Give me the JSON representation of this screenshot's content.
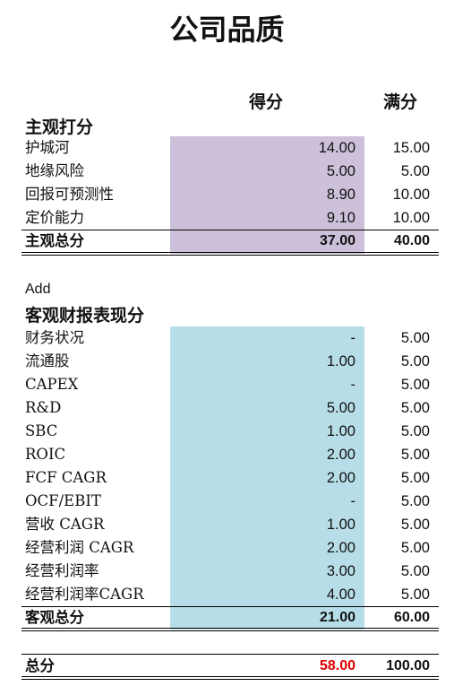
{
  "title": "公司品质",
  "headers": {
    "score": "得分",
    "full": "满分"
  },
  "colors": {
    "subjective_bg": "#ccc0da",
    "objective_bg": "#b7dee8",
    "total_score": "#e00000"
  },
  "subjective": {
    "heading": "主观打分",
    "rows": [
      {
        "label": "护城河",
        "score": "14.00",
        "full": "15.00"
      },
      {
        "label": "地缘风险",
        "score": "5.00",
        "full": "5.00"
      },
      {
        "label": "回报可预测性",
        "score": "8.90",
        "full": "10.00"
      },
      {
        "label": "定价能力",
        "score": "9.10",
        "full": "10.00"
      }
    ],
    "total": {
      "label": "主观总分",
      "score": "37.00",
      "full": "40.00"
    }
  },
  "add_label": "Add",
  "objective": {
    "heading": "客观财报表现分",
    "rows": [
      {
        "label": "财务状况",
        "score": "-",
        "full": "5.00"
      },
      {
        "label": "流通股",
        "score": "1.00",
        "full": "5.00"
      },
      {
        "label": "CAPEX",
        "score": "-",
        "full": "5.00"
      },
      {
        "label": "R&D",
        "score": "5.00",
        "full": "5.00"
      },
      {
        "label": "SBC",
        "score": "1.00",
        "full": "5.00"
      },
      {
        "label": "ROIC",
        "score": "2.00",
        "full": "5.00"
      },
      {
        "label": "FCF CAGR",
        "score": "2.00",
        "full": "5.00"
      },
      {
        "label": "OCF/EBIT",
        "score": "-",
        "full": "5.00"
      },
      {
        "label": "营收 CAGR",
        "score": "1.00",
        "full": "5.00"
      },
      {
        "label": "经营利润 CAGR",
        "score": "2.00",
        "full": "5.00"
      },
      {
        "label": "经营利润率",
        "score": "3.00",
        "full": "5.00"
      },
      {
        "label": "经营利润率CAGR",
        "score": "4.00",
        "full": "5.00"
      }
    ],
    "total": {
      "label": "客观总分",
      "score": "21.00",
      "full": "60.00"
    }
  },
  "grand_total": {
    "label": "总分",
    "score": "58.00",
    "full": "100.00"
  }
}
